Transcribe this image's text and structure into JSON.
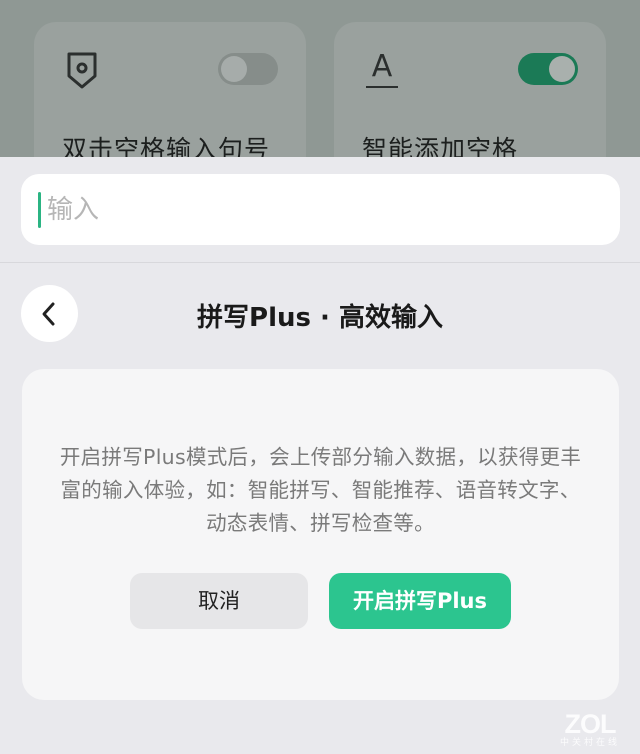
{
  "background": {
    "cards": [
      {
        "label": "双击空格输入句号",
        "icon": "location-tag-icon",
        "toggle_on": false
      },
      {
        "label": "智能添加空格",
        "icon": "text-a-icon",
        "toggle_on": true
      }
    ]
  },
  "search": {
    "placeholder": "输入",
    "value": ""
  },
  "header": {
    "title": "拼写Plus · 高效输入",
    "back_icon": "chevron-left-icon"
  },
  "dialog": {
    "message": "开启拼写Plus模式后，会上传部分输入数据，以获得更丰富的输入体验，如：智能拼写、智能推荐、语音转文字、动态表情、拼写检查等。",
    "cancel_label": "取消",
    "confirm_label": "开启拼写Plus"
  },
  "watermark": {
    "main": "ZOL",
    "sub": "中关村在线"
  },
  "colors": {
    "accent": "#2cc58f",
    "toggle_on": "#1b7a56",
    "panel_bg": "#e9e9ed"
  }
}
